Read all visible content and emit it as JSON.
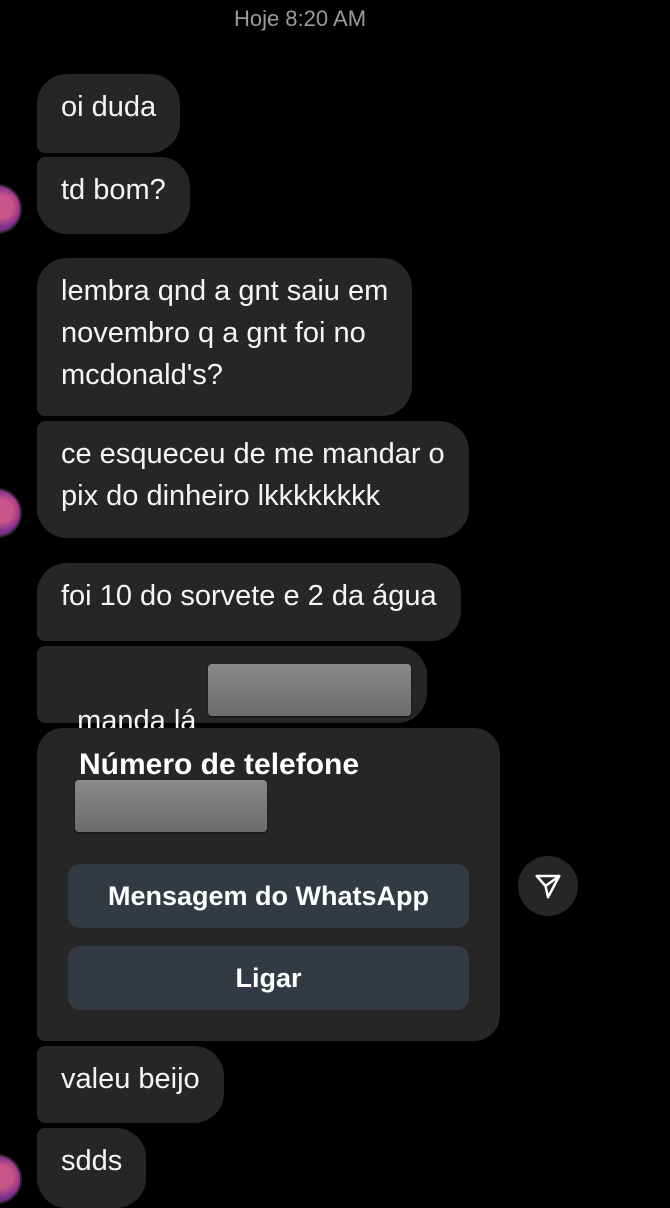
{
  "timestamp": "Hoje 8:20 AM",
  "messages": [
    "oi duda",
    "td bom?",
    "lembra qnd a gnt saiu em\nnovembro q a gnt foi no\nmcdonald's?",
    "ce esqueceu de me mandar o\npix do dinheiro lkkkkkkkk",
    "foi 10 do sorvete e 2 da água",
    "manda lá"
  ],
  "contact_card": {
    "title": "Número de telefone",
    "whatsapp_label": "Mensagem do WhatsApp",
    "call_label": "Ligar"
  },
  "closing_messages": [
    "valeu beijo",
    "sdds"
  ],
  "icons": {
    "avatar": "avatar",
    "share": "send-icon"
  }
}
